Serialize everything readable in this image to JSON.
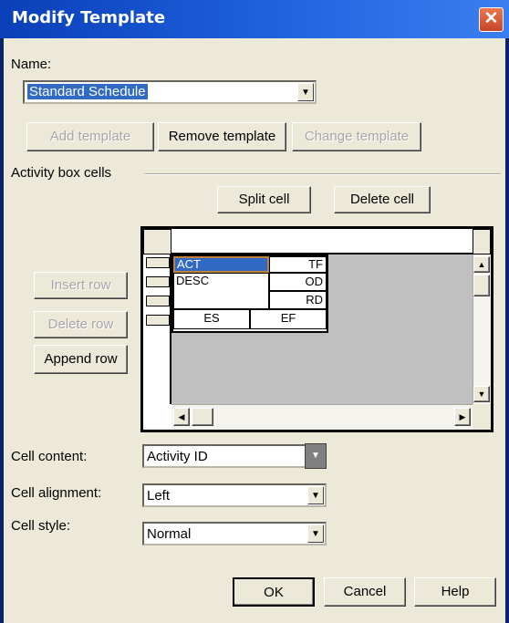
{
  "window": {
    "title": "Modify Template",
    "close_glyph": "✕"
  },
  "name_section": {
    "label": "Name:",
    "selected": "Standard Schedule"
  },
  "template_buttons": {
    "add": "Add template",
    "remove": "Remove template",
    "change": "Change template"
  },
  "activity_box": {
    "group_label": "Activity box cells",
    "split": "Split cell",
    "delete": "Delete cell"
  },
  "row_buttons": {
    "insert": "Insert row",
    "delete": "Delete row",
    "append": "Append row"
  },
  "grid": {
    "selected_cell": "ACT",
    "cells": [
      "TF",
      "DESC",
      "OD",
      "RD",
      "ES",
      "EF"
    ]
  },
  "cell_settings": {
    "content_label": "Cell content:",
    "content_value": "Activity ID",
    "alignment_label": "Cell alignment:",
    "alignment_value": "Left",
    "style_label": "Cell style:",
    "style_value": "Normal"
  },
  "dialog_buttons": {
    "ok": "OK",
    "cancel": "Cancel",
    "help": "Help"
  },
  "colors": {
    "titlebar": "#1f62e0",
    "face": "#ece9d8",
    "selection": "#316ac5"
  }
}
